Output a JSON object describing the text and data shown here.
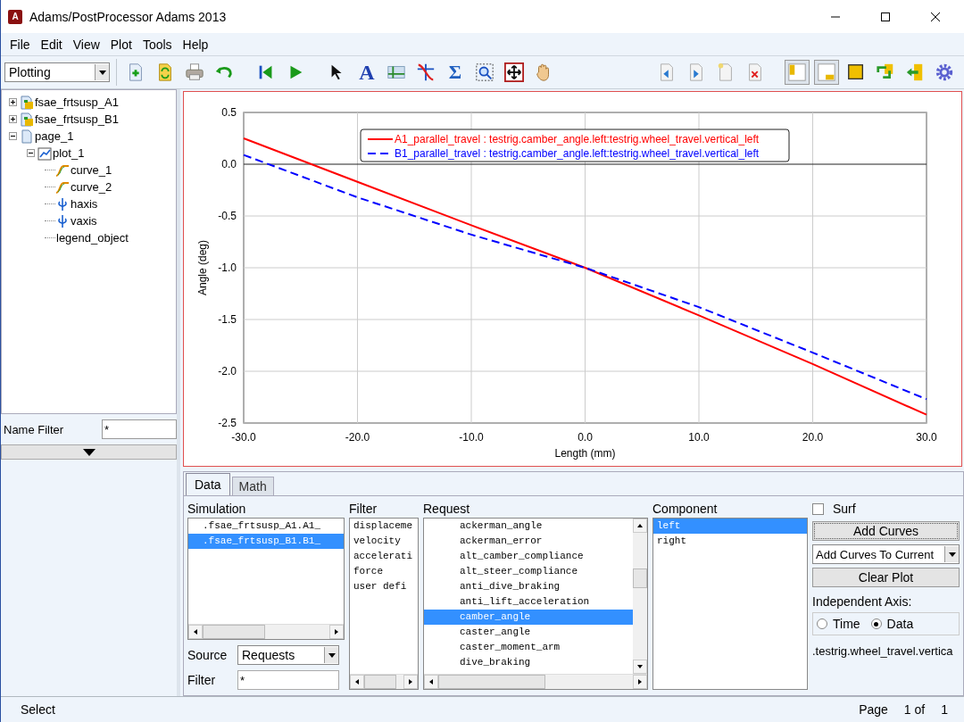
{
  "window": {
    "title": "Adams/PostProcessor Adams 2013",
    "app_icon": "A"
  },
  "menu": [
    "File",
    "Edit",
    "View",
    "Plot",
    "Tools",
    "Help"
  ],
  "toolbar": {
    "mode": "Plotting",
    "left": [
      {
        "kind": "new-page"
      },
      {
        "kind": "refresh"
      },
      {
        "kind": "print"
      },
      {
        "kind": "undo"
      },
      {
        "kind": "first"
      },
      {
        "kind": "play"
      },
      {
        "kind": "pointer"
      },
      {
        "kind": "text-tool",
        "text": "A"
      },
      {
        "kind": "axes"
      },
      {
        "kind": "curve-edit"
      },
      {
        "kind": "sum-tool",
        "text": "Σ"
      },
      {
        "kind": "zoom-box"
      },
      {
        "kind": "fit"
      },
      {
        "kind": "hand"
      }
    ],
    "right": [
      {
        "kind": "prev-page",
        "pressed": false
      },
      {
        "kind": "next-page",
        "pressed": false
      },
      {
        "kind": "blank-page",
        "pressed": false
      },
      {
        "kind": "delete-page",
        "pressed": false
      },
      {
        "kind": "layout-left",
        "pressed": true
      },
      {
        "kind": "layout-bottom",
        "pressed": true
      },
      {
        "kind": "square",
        "pressed": false
      },
      {
        "kind": "swap",
        "pressed": false
      },
      {
        "kind": "back",
        "pressed": false
      },
      {
        "kind": "gear",
        "pressed": false
      }
    ]
  },
  "tree": [
    {
      "label": "fsae_frtsusp_A1",
      "kind": "model",
      "expanded": false
    },
    {
      "label": "fsae_frtsusp_B1",
      "kind": "model",
      "expanded": false
    },
    {
      "label": "page_1",
      "kind": "page",
      "expanded": true,
      "children": [
        {
          "label": "plot_1",
          "kind": "plot",
          "expanded": true,
          "children": [
            {
              "label": "curve_1",
              "kind": "curve"
            },
            {
              "label": "curve_2",
              "kind": "curve"
            },
            {
              "label": "haxis",
              "kind": "axis"
            },
            {
              "label": "vaxis",
              "kind": "axis"
            },
            {
              "label": "legend_object",
              "kind": "plain"
            }
          ]
        }
      ]
    }
  ],
  "name_filter": {
    "label": "Name Filter",
    "value": "*"
  },
  "chart_data": {
    "type": "line",
    "xlabel": "Length (mm)",
    "ylabel": "Angle (deg)",
    "x": [
      -30,
      -20,
      -10,
      0,
      10,
      20,
      30
    ],
    "series": [
      {
        "name": "A1_parallel_travel : testrig.camber_angle.left:testrig.wheel_travel.vertical_left",
        "color": "#ff0000",
        "line_style": "solid",
        "values": [
          0.25,
          -0.17,
          -0.59,
          -1.0,
          -1.46,
          -1.93,
          -2.42
        ]
      },
      {
        "name": "B1_parallel_travel : testrig.camber_angle.left:testrig.wheel_travel.vertical_left",
        "color": "#0000ff",
        "line_style": "dashed",
        "values": [
          0.09,
          -0.32,
          -0.68,
          -1.0,
          -1.38,
          -1.82,
          -2.27
        ]
      }
    ],
    "grid": true,
    "legend": true,
    "xlim": [
      -30,
      30
    ],
    "ylim": [
      -2.5,
      0.5
    ],
    "xticks": [
      {
        "value": -30,
        "label": "-30.0"
      },
      {
        "value": -20,
        "label": "-20.0"
      },
      {
        "value": -10,
        "label": "-10.0"
      },
      {
        "value": 0,
        "label": "0.0"
      },
      {
        "value": 10,
        "label": "10.0"
      },
      {
        "value": 20,
        "label": "20.0"
      },
      {
        "value": 30,
        "label": "30.0"
      }
    ],
    "yticks": [
      {
        "value": 0.5,
        "label": "0.5"
      },
      {
        "value": 0,
        "label": "0.0"
      },
      {
        "value": -0.5,
        "label": "-0.5"
      },
      {
        "value": -1,
        "label": "-1.0"
      },
      {
        "value": -1.5,
        "label": "-1.5"
      },
      {
        "value": -2,
        "label": "-2.0"
      },
      {
        "value": -2.5,
        "label": "-2.5"
      }
    ]
  },
  "tabs": [
    {
      "label": "Data",
      "selected": true
    },
    {
      "label": "Math",
      "selected": false
    }
  ],
  "simulation": {
    "label": "Simulation",
    "items": [
      {
        "text": ".fsae_frtsusp_A1.A1_",
        "selected": false
      },
      {
        "text": ".fsae_frtsusp_B1.B1_",
        "selected": true
      }
    ]
  },
  "filter_list": {
    "label": "Filter",
    "items": [
      {
        "text": "displaceme",
        "selected": false
      },
      {
        "text": "velocity",
        "selected": false
      },
      {
        "text": "accelerati",
        "selected": false
      },
      {
        "text": "force",
        "selected": false
      },
      {
        "text": "user defi",
        "selected": false
      }
    ]
  },
  "request": {
    "label": "Request",
    "items": [
      {
        "text": "ackerman_angle",
        "selected": false
      },
      {
        "text": "ackerman_error",
        "selected": false
      },
      {
        "text": "alt_camber_compliance",
        "selected": false
      },
      {
        "text": "alt_steer_compliance",
        "selected": false
      },
      {
        "text": "anti_dive_braking",
        "selected": false
      },
      {
        "text": "anti_lift_acceleration",
        "selected": false
      },
      {
        "text": "camber_angle",
        "selected": true
      },
      {
        "text": "caster_angle",
        "selected": false
      },
      {
        "text": "caster_moment_arm",
        "selected": false
      },
      {
        "text": "dive_braking",
        "selected": false
      }
    ]
  },
  "source": {
    "label": "Source",
    "value": "Requests"
  },
  "filter_field": {
    "label": "Filter",
    "value": "*"
  },
  "component": {
    "label": "Component",
    "items": [
      {
        "text": "left",
        "selected": true
      },
      {
        "text": "right",
        "selected": false
      }
    ]
  },
  "surf": {
    "label": "Surf",
    "checked": false
  },
  "add_curves": "Add Curves",
  "add_mode": "Add Curves To Current",
  "clear_plot": "Clear Plot",
  "independent_axis": {
    "label": "Independent Axis:",
    "options": [
      {
        "label": "Time",
        "selected": false
      },
      {
        "label": "Data",
        "selected": true
      }
    ],
    "value": ".testrig.wheel_travel.vertica"
  },
  "status_bar": {
    "message": "Select",
    "page_label": "Page",
    "page_of": "1 of",
    "page_total": "1"
  }
}
